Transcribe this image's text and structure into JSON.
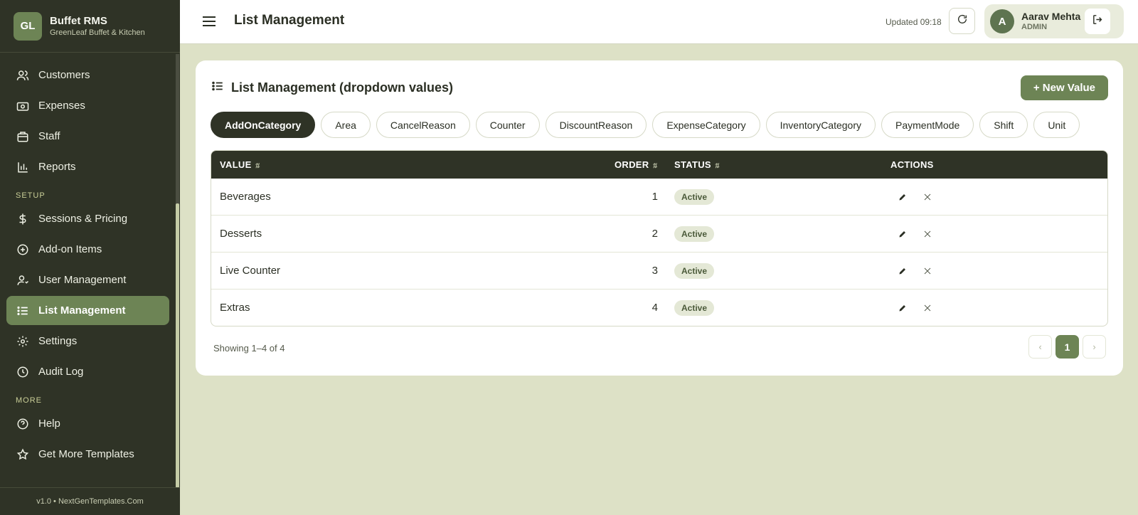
{
  "brand": {
    "logo": "GL",
    "title": "Buffet RMS",
    "subtitle": "GreenLeaf Buffet & Kitchen"
  },
  "sidebar": {
    "items_top": [
      {
        "label": "Customers",
        "icon": "users-icon"
      },
      {
        "label": "Expenses",
        "icon": "camera-icon"
      },
      {
        "label": "Staff",
        "icon": "briefcase-icon"
      },
      {
        "label": "Reports",
        "icon": "bar-chart-icon"
      }
    ],
    "section_setup": "SETUP",
    "items_setup": [
      {
        "label": "Sessions & Pricing",
        "icon": "dollar-icon"
      },
      {
        "label": "Add-on Items",
        "icon": "plus-circle-icon"
      },
      {
        "label": "User Management",
        "icon": "user-icon"
      },
      {
        "label": "List Management",
        "icon": "list-icon",
        "active": true
      },
      {
        "label": "Settings",
        "icon": "gear-icon"
      },
      {
        "label": "Audit Log",
        "icon": "clock-icon"
      }
    ],
    "section_more": "MORE",
    "items_more": [
      {
        "label": "Help",
        "icon": "help-circle-icon"
      },
      {
        "label": "Get More Templates",
        "icon": "star-icon"
      }
    ],
    "footer": "v1.0 • NextGenTemplates.Com"
  },
  "topbar": {
    "title": "List Management",
    "updated": "Updated 09:18",
    "user": {
      "initial": "A",
      "name": "Aarav Mehta",
      "role": "ADMIN"
    }
  },
  "card": {
    "title": "List Management (dropdown values)",
    "new_button": "+ New Value",
    "chips": [
      "AddOnCategory",
      "Area",
      "CancelReason",
      "Counter",
      "DiscountReason",
      "ExpenseCategory",
      "InventoryCategory",
      "PaymentMode",
      "Shift",
      "Unit"
    ],
    "active_chip": "AddOnCategory",
    "table": {
      "headers": {
        "value": "VALUE",
        "order": "ORDER",
        "status": "STATUS",
        "actions": "ACTIONS"
      },
      "rows": [
        {
          "value": "Beverages",
          "order": "1",
          "status": "Active"
        },
        {
          "value": "Desserts",
          "order": "2",
          "status": "Active"
        },
        {
          "value": "Live Counter",
          "order": "3",
          "status": "Active"
        },
        {
          "value": "Extras",
          "order": "4",
          "status": "Active"
        }
      ]
    },
    "showing": "Showing 1–4 of 4",
    "pagination": {
      "prev": "‹",
      "current": "1",
      "next": "›"
    }
  },
  "colors": {
    "sidebar_bg": "#2f3326",
    "accent": "#6d8455",
    "page_bg": "#dde1c6"
  }
}
